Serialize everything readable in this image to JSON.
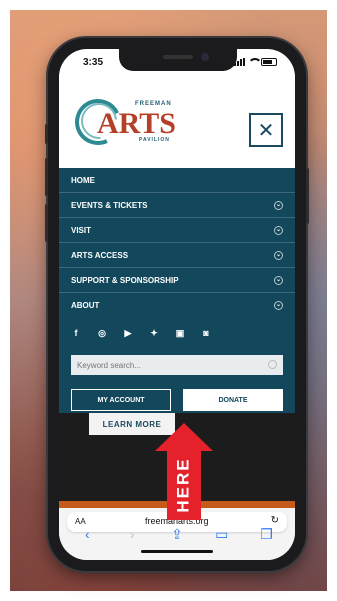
{
  "status_bar": {
    "time": "3:35"
  },
  "header": {
    "logo_word": "ARTS",
    "logo_top": "FREEMAN",
    "logo_bottom": "PAVILION",
    "close_icon": "✕"
  },
  "nav": {
    "items": [
      {
        "label": "HOME",
        "has_submenu": false
      },
      {
        "label": "EVENTS & TICKETS",
        "has_submenu": true
      },
      {
        "label": "VISIT",
        "has_submenu": true
      },
      {
        "label": "ARTS ACCESS",
        "has_submenu": true
      },
      {
        "label": "SUPPORT & SPONSORSHIP",
        "has_submenu": true
      },
      {
        "label": "ABOUT",
        "has_submenu": true
      }
    ],
    "socials": [
      "facebook-icon",
      "instagram-icon",
      "youtube-icon",
      "twitter-icon",
      "flickr-icon",
      "spotify-icon"
    ],
    "search_placeholder": "Keyword search...",
    "account_label": "MY ACCOUNT",
    "donate_label": "DONATE"
  },
  "content": {
    "learn_more": "LEARN MORE"
  },
  "annotation": {
    "text": "HERE",
    "color": "#e5212c"
  },
  "browser": {
    "aa": "AA",
    "url": "freemanarts.org"
  },
  "colors": {
    "nav_bg": "#12475c",
    "logo_red": "#b5402a",
    "logo_teal": "#2e8a92",
    "accent_orange": "#c65a1b"
  }
}
